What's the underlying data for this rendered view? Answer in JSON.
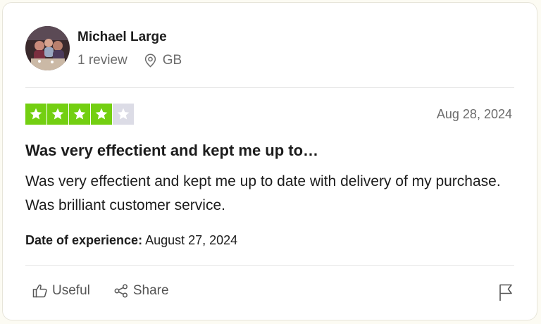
{
  "reviewer": {
    "name": "Michael Large",
    "review_count": "1 review",
    "country": "GB",
    "location_icon": "location-pin-icon"
  },
  "review": {
    "rating": 4,
    "max_rating": 5,
    "date_published": "Aug 28, 2024",
    "title": "Was very effectient and kept me up to…",
    "body": "Was very effectient and kept me up to date with delivery of my purchase. Was brilliant customer service.",
    "experience_label": "Date of experience:",
    "experience_date": "August 27, 2024"
  },
  "actions": {
    "useful_label": "Useful",
    "share_label": "Share",
    "useful_icon": "thumbs-up-icon",
    "share_icon": "share-icon",
    "report_icon": "flag-icon"
  },
  "colors": {
    "star_filled": "#73cf11",
    "star_empty": "#dcdce6",
    "text_primary": "#1c1c1c",
    "text_secondary": "#6b6b6b"
  }
}
